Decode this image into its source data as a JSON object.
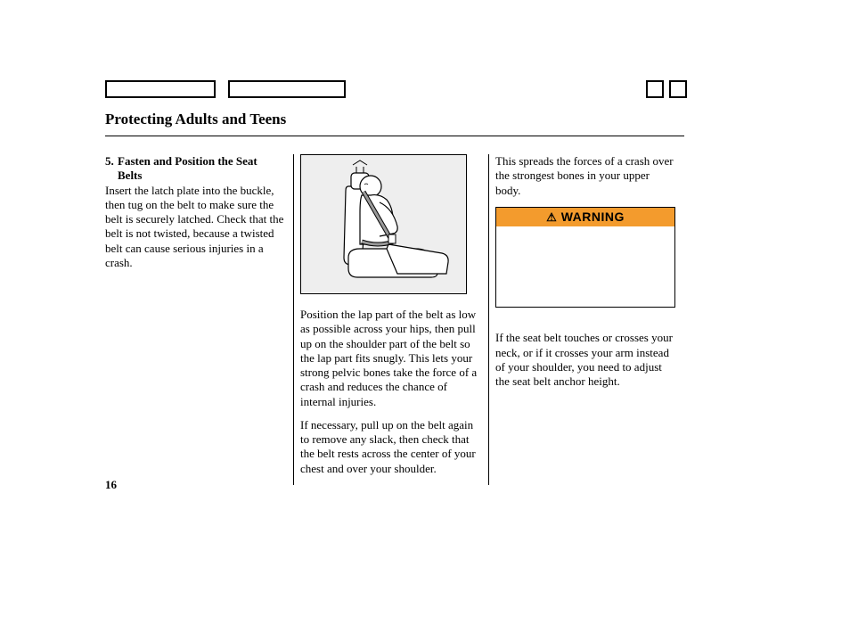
{
  "page_title": "Protecting Adults and Teens",
  "page_number": "16",
  "step": {
    "number": "5.",
    "title_line1": "Fasten and Position the Seat",
    "title_line2": "Belts"
  },
  "col1": {
    "p1": "Insert the latch plate into the buckle, then tug on the belt to make sure the belt is securely latched. Check that the belt is not twisted, because a twisted belt can cause serious injuries in a crash."
  },
  "col2": {
    "p1": "Position the lap part of the belt as low as possible across your hips, then pull up on the shoulder part of the belt so the lap part fits snugly. This lets your strong pelvic bones take the force of a crash and reduces the chance of internal injuries.",
    "p2": "If necessary, pull up on the belt again to remove any slack, then check that the belt rests across the center of your chest and over your shoulder."
  },
  "col3": {
    "p1": "This spreads the forces of a crash over the strongest bones in your upper body.",
    "warning_label": "WARNING",
    "p2": "If the seat belt touches or crosses your neck, or if it crosses your arm instead of your shoulder, you need to adjust the seat belt anchor height."
  },
  "illustration_name": "seatbelt-position-illustration"
}
